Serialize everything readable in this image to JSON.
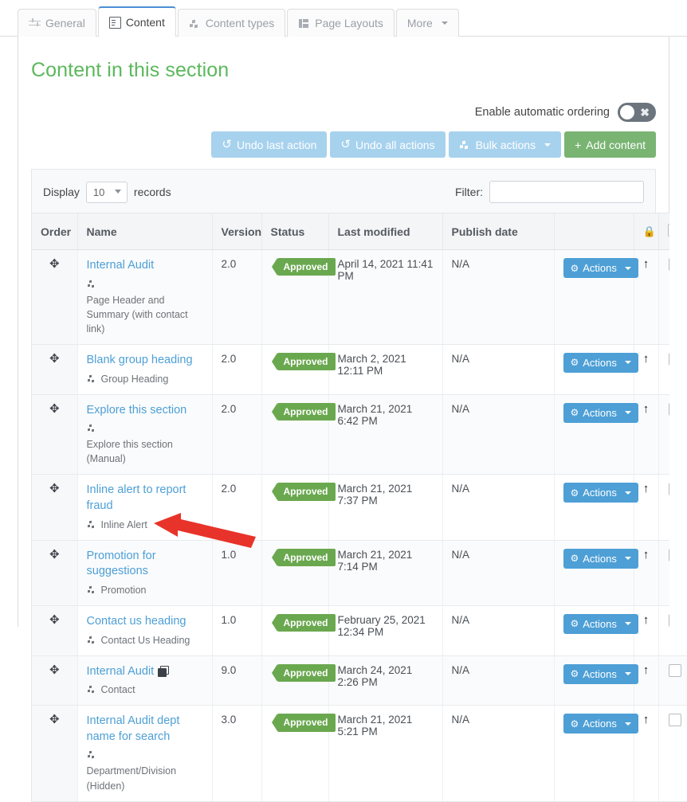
{
  "tabs": [
    {
      "label": "General",
      "icon": "sliders-icon",
      "active": false
    },
    {
      "label": "Content",
      "icon": "document-icon",
      "active": true
    },
    {
      "label": "Content types",
      "icon": "cubes-icon",
      "active": false
    },
    {
      "label": "Page Layouts",
      "icon": "layout-icon",
      "active": false
    },
    {
      "label": "More",
      "icon": "caret-down-icon",
      "active": false
    }
  ],
  "page": {
    "title": "Content in this section",
    "title_color": "#5cb85c"
  },
  "ordering": {
    "label": "Enable automatic ordering",
    "state": "off",
    "x_glyph": "✖"
  },
  "toolbar": {
    "undo_last": "Undo last action",
    "undo_all": "Undo all actions",
    "bulk_actions": "Bulk actions",
    "add_content": "Add content",
    "undo_glyph": "↺",
    "plus_glyph": "+",
    "blue": "#a7d2ee",
    "green": "#79b473"
  },
  "controls": {
    "display_label": "Display",
    "records_label": "records",
    "page_size": "10",
    "filter_label": "Filter:",
    "filter_value": "",
    "filter_placeholder": ""
  },
  "table": {
    "columns": [
      "Order",
      "Name",
      "Version",
      "Status",
      "Last modified",
      "Publish date",
      "",
      "",
      ""
    ],
    "lock_glyph": "🔒",
    "move_glyph": "✥",
    "up_glyph": "↑",
    "actions_label": "Actions",
    "gear_glyph": "⚙",
    "rows": [
      {
        "name": "Internal Audit",
        "type": "Page Header and Summary (with contact link)",
        "version": "2.0",
        "status": "Approved",
        "last_modified": "April 14, 2021 11:41 PM",
        "publish_date": "N/A",
        "duplicate": false
      },
      {
        "name": "Blank group heading",
        "type": "Group Heading",
        "version": "2.0",
        "status": "Approved",
        "last_modified": "March 2, 2021 12:11 PM",
        "publish_date": "N/A",
        "duplicate": false
      },
      {
        "name": "Explore this section",
        "type": "Explore this section (Manual)",
        "version": "2.0",
        "status": "Approved",
        "last_modified": "March 21, 2021 6:42 PM",
        "publish_date": "N/A",
        "duplicate": false
      },
      {
        "name": "Inline alert to report fraud",
        "type": "Inline Alert",
        "version": "2.0",
        "status": "Approved",
        "last_modified": "March 21, 2021 7:37 PM",
        "publish_date": "N/A",
        "duplicate": false
      },
      {
        "name": "Promotion for suggestions",
        "type": "Promotion",
        "version": "1.0",
        "status": "Approved",
        "last_modified": "March 21, 2021 7:14 PM",
        "publish_date": "N/A",
        "duplicate": false
      },
      {
        "name": "Contact us heading",
        "type": "Contact Us Heading",
        "version": "1.0",
        "status": "Approved",
        "last_modified": "February 25, 2021 12:34 PM",
        "publish_date": "N/A",
        "duplicate": false
      },
      {
        "name": "Internal Audit",
        "type": "Contact",
        "version": "9.0",
        "status": "Approved",
        "last_modified": "March 24, 2021 2:26 PM",
        "publish_date": "N/A",
        "duplicate": true
      },
      {
        "name": "Internal Audit dept name for search",
        "type": "Department/Division (Hidden)",
        "version": "3.0",
        "status": "Approved",
        "last_modified": "March 21, 2021 5:21 PM",
        "publish_date": "N/A",
        "duplicate": false
      }
    ]
  },
  "annotation": {
    "type": "red-arrow",
    "color": "#e8332a",
    "points_to": "duplicate-icon"
  }
}
